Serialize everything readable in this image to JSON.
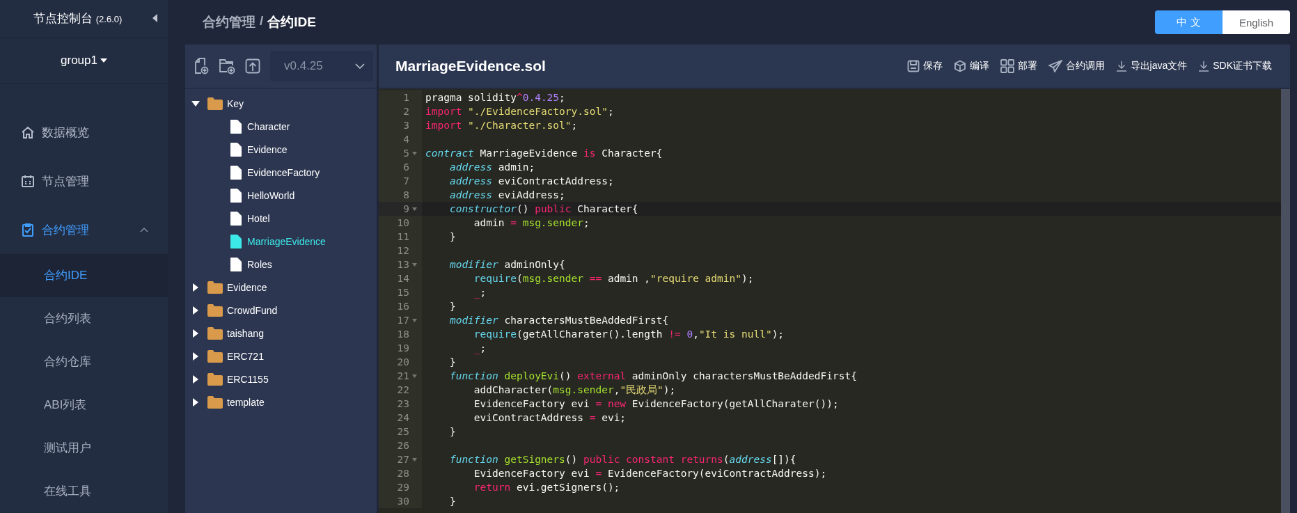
{
  "sidebar": {
    "title": "节点控制台",
    "version": "(2.6.0)",
    "group": "group1",
    "menu": [
      {
        "label": "数据概览",
        "active": false
      },
      {
        "label": "节点管理",
        "active": false
      },
      {
        "label": "合约管理",
        "active": true,
        "expanded": true,
        "children": [
          {
            "label": "合约IDE",
            "selected": true
          },
          {
            "label": "合约列表",
            "selected": false
          },
          {
            "label": "合约仓库",
            "selected": false
          },
          {
            "label": "ABI列表",
            "selected": false
          },
          {
            "label": "测试用户",
            "selected": false
          },
          {
            "label": "在线工具",
            "selected": false
          }
        ]
      }
    ]
  },
  "breadcrumb": {
    "parent": "合约管理",
    "separator": "/",
    "current": "合约IDE"
  },
  "language": [
    {
      "label": "中 文",
      "selected": true
    },
    {
      "label": "English",
      "selected": false
    }
  ],
  "file_panel": {
    "version": "v0.4.25",
    "tree": [
      {
        "kind": "folder",
        "name": "Key",
        "expanded": true,
        "selected": false,
        "children": [
          {
            "kind": "file",
            "name": "Character",
            "selected": false
          },
          {
            "kind": "file",
            "name": "Evidence",
            "selected": false
          },
          {
            "kind": "file",
            "name": "EvidenceFactory",
            "selected": false
          },
          {
            "kind": "file",
            "name": "HelloWorld",
            "selected": false
          },
          {
            "kind": "file",
            "name": "Hotel",
            "selected": false
          },
          {
            "kind": "file",
            "name": "MarriageEvidence",
            "selected": true
          },
          {
            "kind": "file",
            "name": "Roles",
            "selected": false
          }
        ]
      },
      {
        "kind": "folder",
        "name": "Evidence",
        "expanded": false,
        "selected": false
      },
      {
        "kind": "folder",
        "name": "CrowdFund",
        "expanded": false,
        "selected": false
      },
      {
        "kind": "folder",
        "name": "taishang",
        "expanded": false,
        "selected": false
      },
      {
        "kind": "folder",
        "name": "ERC721",
        "expanded": false,
        "selected": false
      },
      {
        "kind": "folder",
        "name": "ERC1155",
        "expanded": false,
        "selected": false
      },
      {
        "kind": "folder",
        "name": "template",
        "expanded": false,
        "selected": false
      }
    ]
  },
  "editor": {
    "file_name": "MarriageEvidence.sol",
    "actions": [
      {
        "label": "保存"
      },
      {
        "label": "编译"
      },
      {
        "label": "部署"
      },
      {
        "label": "合约调用"
      },
      {
        "label": "导出java文件"
      },
      {
        "label": "SDK证书下载"
      }
    ],
    "lines": [
      {
        "number": "1",
        "foldable": false,
        "current": false,
        "tokens": [
          {
            "kind": "plain",
            "text": "pragma solidity"
          },
          {
            "kind": "keyword",
            "text": "^"
          },
          {
            "kind": "number",
            "text": "0.4.25"
          },
          {
            "kind": "plain",
            "text": ";"
          }
        ]
      },
      {
        "number": "2",
        "foldable": false,
        "current": false,
        "tokens": [
          {
            "kind": "keyword",
            "text": "import"
          },
          {
            "kind": "string",
            "text": " \"./EvidenceFactory.sol\""
          },
          {
            "kind": "plain",
            "text": ";"
          }
        ]
      },
      {
        "number": "3",
        "foldable": false,
        "current": false,
        "tokens": [
          {
            "kind": "keyword",
            "text": "import"
          },
          {
            "kind": "string",
            "text": " \"./Character.sol\""
          },
          {
            "kind": "plain",
            "text": ";"
          }
        ]
      },
      {
        "number": "4",
        "foldable": false,
        "current": false
      },
      {
        "number": "5",
        "foldable": true,
        "current": false,
        "tokens": [
          {
            "kind": "type",
            "text": "contract"
          },
          {
            "kind": "plain",
            "text": " MarriageEvidence "
          },
          {
            "kind": "keyword",
            "text": "is"
          },
          {
            "kind": "plain",
            "text": " Character{"
          }
        ]
      },
      {
        "number": "6",
        "foldable": false,
        "current": false,
        "tokens": [
          {
            "kind": "type",
            "text": "    address"
          },
          {
            "kind": "plain",
            "text": " admin;"
          }
        ]
      },
      {
        "number": "7",
        "foldable": false,
        "current": false,
        "tokens": [
          {
            "kind": "type",
            "text": "    address"
          },
          {
            "kind": "plain",
            "text": " eviContractAddress;"
          }
        ]
      },
      {
        "number": "8",
        "foldable": false,
        "current": false,
        "tokens": [
          {
            "kind": "type",
            "text": "    address"
          },
          {
            "kind": "plain",
            "text": " eviAddress;"
          }
        ]
      },
      {
        "number": "9",
        "foldable": true,
        "current": true,
        "tokens": [
          {
            "kind": "type",
            "text": "    constructor"
          },
          {
            "kind": "plain",
            "text": "() "
          },
          {
            "kind": "keyword",
            "text": "public"
          },
          {
            "kind": "plain",
            "text": " Character{"
          }
        ]
      },
      {
        "number": "10",
        "foldable": false,
        "current": false,
        "tokens": [
          {
            "kind": "plain",
            "text": "        admin "
          },
          {
            "kind": "keyword",
            "text": "="
          },
          {
            "kind": "name",
            "text": " msg.sender"
          },
          {
            "kind": "plain",
            "text": ";"
          }
        ]
      },
      {
        "number": "11",
        "foldable": false,
        "current": false,
        "tokens": [
          {
            "kind": "plain",
            "text": "    }"
          }
        ]
      },
      {
        "number": "12",
        "foldable": false,
        "current": false
      },
      {
        "number": "13",
        "foldable": true,
        "current": false,
        "tokens": [
          {
            "kind": "type",
            "text": "    modifier"
          },
          {
            "kind": "plain",
            "text": " adminOnly{"
          }
        ]
      },
      {
        "number": "14",
        "foldable": false,
        "current": false,
        "tokens": [
          {
            "kind": "builtin",
            "text": "        require"
          },
          {
            "kind": "plain",
            "text": "("
          },
          {
            "kind": "name",
            "text": "msg.sender"
          },
          {
            "kind": "keyword",
            "text": " =="
          },
          {
            "kind": "plain",
            "text": " admin ,"
          },
          {
            "kind": "string",
            "text": "\"require admin\""
          },
          {
            "kind": "plain",
            "text": ");"
          }
        ]
      },
      {
        "number": "15",
        "foldable": false,
        "current": false,
        "tokens": [
          {
            "kind": "keyword",
            "text": "        _"
          },
          {
            "kind": "plain",
            "text": ";"
          }
        ]
      },
      {
        "number": "16",
        "foldable": false,
        "current": false,
        "tokens": [
          {
            "kind": "plain",
            "text": "    }"
          }
        ]
      },
      {
        "number": "17",
        "foldable": true,
        "current": false,
        "tokens": [
          {
            "kind": "type",
            "text": "    modifier"
          },
          {
            "kind": "plain",
            "text": " charactersMustBeAddedFirst{"
          }
        ]
      },
      {
        "number": "18",
        "foldable": false,
        "current": false,
        "tokens": [
          {
            "kind": "builtin",
            "text": "        require"
          },
          {
            "kind": "plain",
            "text": "(getAllCharater().length "
          },
          {
            "kind": "keyword",
            "text": "!="
          },
          {
            "kind": "number",
            "text": " 0"
          },
          {
            "kind": "plain",
            "text": ","
          },
          {
            "kind": "string",
            "text": "\"It is null\""
          },
          {
            "kind": "plain",
            "text": ");"
          }
        ]
      },
      {
        "number": "19",
        "foldable": false,
        "current": false,
        "tokens": [
          {
            "kind": "keyword",
            "text": "        _"
          },
          {
            "kind": "plain",
            "text": ";"
          }
        ]
      },
      {
        "number": "20",
        "foldable": false,
        "current": false,
        "tokens": [
          {
            "kind": "plain",
            "text": "    }"
          }
        ]
      },
      {
        "number": "21",
        "foldable": true,
        "current": false,
        "tokens": [
          {
            "kind": "type",
            "text": "    function"
          },
          {
            "kind": "name",
            "text": " deployEvi"
          },
          {
            "kind": "plain",
            "text": "() "
          },
          {
            "kind": "keyword",
            "text": "external"
          },
          {
            "kind": "plain",
            "text": " adminOnly charactersMustBeAddedFirst{"
          }
        ]
      },
      {
        "number": "22",
        "foldable": false,
        "current": false,
        "tokens": [
          {
            "kind": "plain",
            "text": "        addCharacter("
          },
          {
            "kind": "name",
            "text": "msg.sender"
          },
          {
            "kind": "plain",
            "text": ","
          },
          {
            "kind": "string",
            "text": "\"民政局\""
          },
          {
            "kind": "plain",
            "text": ");"
          }
        ]
      },
      {
        "number": "23",
        "foldable": false,
        "current": false,
        "tokens": [
          {
            "kind": "plain",
            "text": "        EvidenceFactory evi "
          },
          {
            "kind": "keyword",
            "text": "="
          },
          {
            "kind": "keyword",
            "text": " new"
          },
          {
            "kind": "plain",
            "text": " EvidenceFactory(getAllCharater());"
          }
        ]
      },
      {
        "number": "24",
        "foldable": false,
        "current": false,
        "tokens": [
          {
            "kind": "plain",
            "text": "        eviContractAddress "
          },
          {
            "kind": "keyword",
            "text": "="
          },
          {
            "kind": "plain",
            "text": " evi;"
          }
        ]
      },
      {
        "number": "25",
        "foldable": false,
        "current": false,
        "tokens": [
          {
            "kind": "plain",
            "text": "    }"
          }
        ]
      },
      {
        "number": "26",
        "foldable": false,
        "current": false
      },
      {
        "number": "27",
        "foldable": true,
        "current": false,
        "tokens": [
          {
            "kind": "type",
            "text": "    function"
          },
          {
            "kind": "name",
            "text": " getSigners"
          },
          {
            "kind": "plain",
            "text": "() "
          },
          {
            "kind": "keyword",
            "text": "public constant returns"
          },
          {
            "kind": "plain",
            "text": "("
          },
          {
            "kind": "type",
            "text": "address"
          },
          {
            "kind": "plain",
            "text": "[]){"
          }
        ]
      },
      {
        "number": "28",
        "foldable": false,
        "current": false,
        "tokens": [
          {
            "kind": "plain",
            "text": "        EvidenceFactory evi "
          },
          {
            "kind": "keyword",
            "text": "="
          },
          {
            "kind": "plain",
            "text": " EvidenceFactory(eviContractAddress);"
          }
        ]
      },
      {
        "number": "29",
        "foldable": false,
        "current": false,
        "tokens": [
          {
            "kind": "keyword",
            "text": "        return"
          },
          {
            "kind": "plain",
            "text": " evi.getSigners();"
          }
        ]
      },
      {
        "number": "30",
        "foldable": false,
        "current": false,
        "tokens": [
          {
            "kind": "plain",
            "text": "    }"
          }
        ]
      }
    ]
  }
}
